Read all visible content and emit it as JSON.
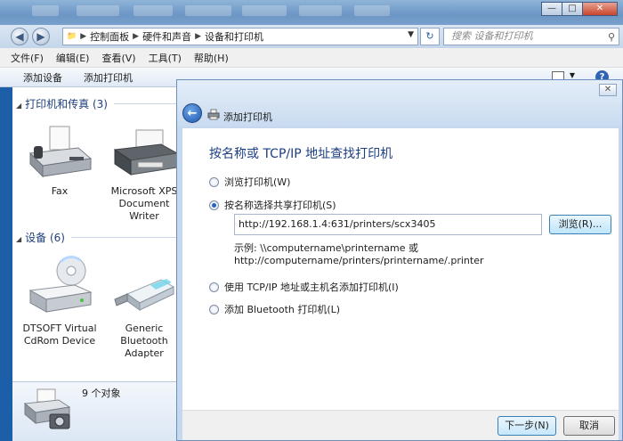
{
  "explorer": {
    "address": {
      "crumbs": [
        "控制面板",
        "硬件和声音",
        "设备和打印机"
      ]
    },
    "search_placeholder": "搜索 设备和打印机",
    "menu": [
      "文件(F)",
      "编辑(E)",
      "查看(V)",
      "工具(T)",
      "帮助(H)"
    ],
    "toolbar": {
      "add_device": "添加设备",
      "add_printer": "添加打印机"
    },
    "sections": {
      "printers": {
        "title": "打印机和传真 (3)",
        "items": [
          "Fax",
          "Microsoft XPS Document Writer"
        ]
      },
      "devices": {
        "title": "设备 (6)",
        "items": [
          "DTSOFT Virtual CdRom Device",
          "Generic Bluetooth Adapter"
        ]
      }
    },
    "details": {
      "count": "9 个对象"
    }
  },
  "dialog": {
    "title": "添加打印机",
    "heading": "按名称或 TCP/IP 地址查找打印机",
    "options": [
      {
        "label": "浏览打印机(W)",
        "selected": false
      },
      {
        "label": "按名称选择共享打印机(S)",
        "selected": true
      },
      {
        "label": "使用 TCP/IP 地址或主机名添加打印机(I)",
        "selected": false
      },
      {
        "label": "添加 Bluetooth 打印机(L)",
        "selected": false
      }
    ],
    "share_value": "http://192.168.1.4:631/printers/scx3405",
    "browse_label": "浏览(R)...",
    "example_line1": "示例: \\\\computername\\printername 或",
    "example_line2": "http://computername/printers/printername/.printer",
    "next_label": "下一步(N)",
    "cancel_label": "取消"
  },
  "colors": {
    "accent": "#1c3f82",
    "radio_selected": "#2862c6"
  }
}
